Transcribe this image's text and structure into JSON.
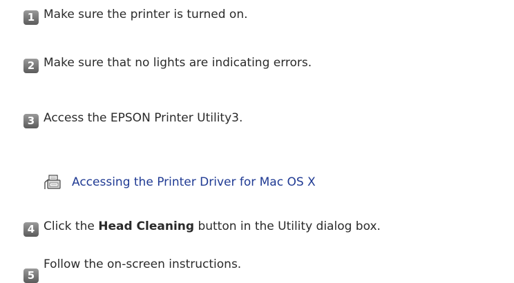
{
  "steps": [
    {
      "number": "1",
      "text": "Make sure the printer is turned on."
    },
    {
      "number": "2",
      "text": "Make sure that no lights are indicating errors."
    },
    {
      "number": "3",
      "text": "Access the EPSON Printer Utility3."
    },
    {
      "number": "4",
      "text_before": "Click the ",
      "text_bold": "Head Cleaning",
      "text_after": " button in the Utility dialog box."
    },
    {
      "number": "5",
      "text": "Follow the on-screen instructions."
    }
  ],
  "link": {
    "icon": "printer-driver-icon",
    "label": "Accessing the Printer Driver for Mac OS X"
  },
  "colors": {
    "badge": "#6e6e6e",
    "link": "#1f3a93",
    "text": "#2a2a2a"
  }
}
